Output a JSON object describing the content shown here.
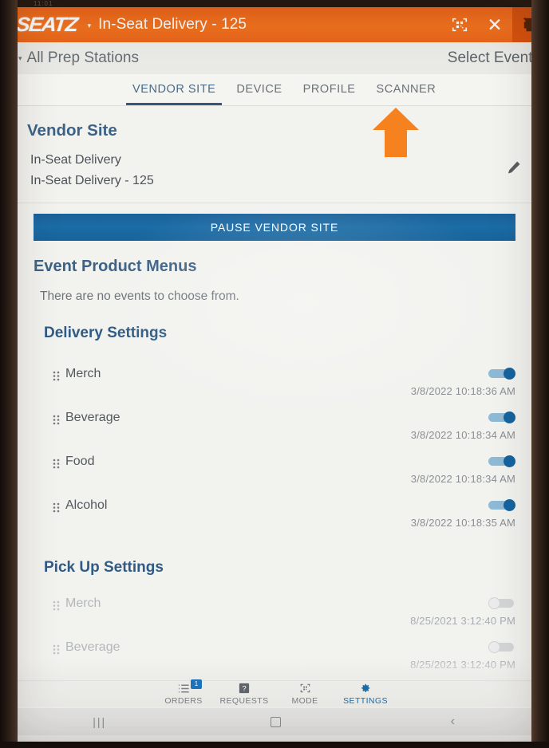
{
  "device": {
    "status_bar_time": "11:01",
    "system_nav": {
      "recents": "|||",
      "home": "home-square",
      "back": "‹"
    }
  },
  "appbar": {
    "logo": "SEATZ",
    "caret": "▾",
    "title": "In-Seat Delivery - 125",
    "icons": {
      "scan": "qr-scan-icon",
      "close": "✕",
      "printer": "printer-disabled-icon"
    }
  },
  "prepbar": {
    "caret": "▾",
    "prep_stations": "All Prep Stations",
    "select_event": "Select Event",
    "event_caret": "▾"
  },
  "tabs": [
    {
      "label": "VENDOR SITE",
      "active": true
    },
    {
      "label": "DEVICE",
      "active": false
    },
    {
      "label": "PROFILE",
      "active": false
    },
    {
      "label": "SCANNER",
      "active": false
    }
  ],
  "annotation": {
    "arrow": "up-arrow-pointing-to-scanner-tab",
    "color": "#F5821F"
  },
  "vendor_site": {
    "heading": "Vendor Site",
    "line1": "In-Seat Delivery",
    "line2": "In-Seat Delivery - 125",
    "edit_icon": "pencil-icon",
    "pause_button": "PAUSE VENDOR SITE"
  },
  "event_product_menus": {
    "heading": "Event Product Menus",
    "empty_text": "There are no events to choose from."
  },
  "delivery_settings": {
    "heading": "Delivery Settings",
    "rows": [
      {
        "label": "Merch",
        "timestamp": "3/8/2022 10:18:36 AM",
        "enabled": true
      },
      {
        "label": "Beverage",
        "timestamp": "3/8/2022 10:18:34 AM",
        "enabled": true
      },
      {
        "label": "Food",
        "timestamp": "3/8/2022 10:18:34 AM",
        "enabled": true
      },
      {
        "label": "Alcohol",
        "timestamp": "3/8/2022 10:18:35 AM",
        "enabled": true
      }
    ]
  },
  "pickup_settings": {
    "heading": "Pick Up Settings",
    "rows": [
      {
        "label": "Merch",
        "timestamp": "8/25/2021 3:12:40 PM",
        "enabled": false
      },
      {
        "label": "Beverage",
        "timestamp": "8/25/2021 3:12:40 PM",
        "enabled": false
      }
    ]
  },
  "bottom_nav": [
    {
      "label": "ORDERS",
      "icon": "list-icon",
      "badge": "1",
      "active": false
    },
    {
      "label": "REQUESTS",
      "icon": "help-box-icon",
      "badge": "",
      "active": false
    },
    {
      "label": "MODE",
      "icon": "qr-scan-icon",
      "badge": "",
      "active": false
    },
    {
      "label": "SETTINGS",
      "icon": "gear-icon",
      "badge": "",
      "active": true
    }
  ],
  "colors": {
    "brand_orange": "#F2721F",
    "accent_blue": "#1b6ca6",
    "heading_blue": "#3d6286"
  }
}
